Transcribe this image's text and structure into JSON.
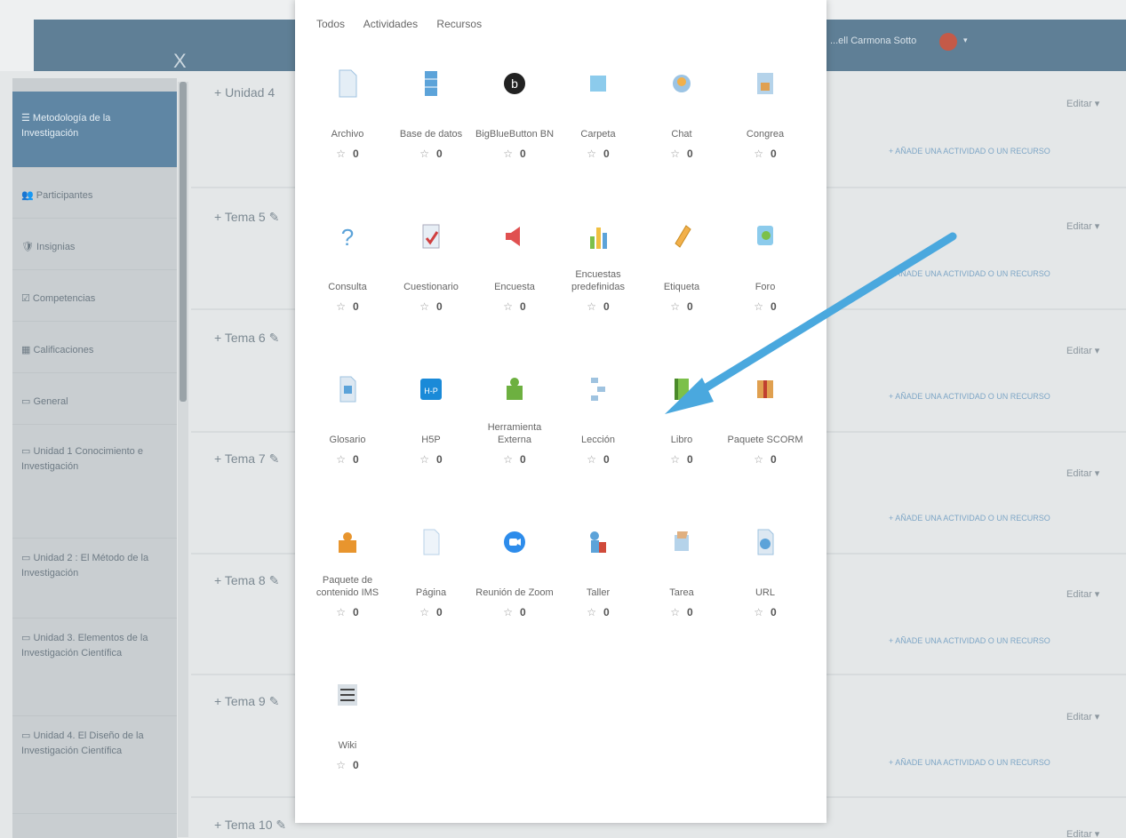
{
  "header": {
    "close_symbol": "X",
    "user_name": "...ell Carmona Sotto",
    "caret": "▾"
  },
  "sidebar": {
    "items": [
      {
        "label": "☰ Metodología de la Investigación",
        "active": true
      },
      {
        "label": "👥 Participantes"
      },
      {
        "label": "🛡 Insignias"
      },
      {
        "label": "☑ Competencias"
      },
      {
        "label": "▦ Calificaciones"
      },
      {
        "label": "▭ General"
      },
      {
        "label": "▭ Unidad 1 Conocimiento e Investigación"
      },
      {
        "label": "▭ Unidad 2 : El Método de la Investigación"
      },
      {
        "label": "▭ Unidad 3. Elementos de la Investigación Científica"
      },
      {
        "label": "▭ Unidad 4. El Diseño de la Investigación Científica"
      }
    ]
  },
  "sections": [
    {
      "title": "+ Unidad 4",
      "edit": "Editar ▾",
      "add": "+ AÑADE UNA ACTIVIDAD O UN RECURSO"
    },
    {
      "title": "+ Tema 5 ✎",
      "edit": "Editar ▾",
      "add": "+ AÑADE UNA ACTIVIDAD O UN RECURSO"
    },
    {
      "title": "+ Tema 6 ✎",
      "edit": "Editar ▾",
      "add": "+ AÑADE UNA ACTIVIDAD O UN RECURSO"
    },
    {
      "title": "+ Tema 7 ✎",
      "edit": "Editar ▾",
      "add": "+ AÑADE UNA ACTIVIDAD O UN RECURSO"
    },
    {
      "title": "+ Tema 8 ✎",
      "edit": "Editar ▾",
      "add": "+ AÑADE UNA ACTIVIDAD O UN RECURSO"
    },
    {
      "title": "+ Tema 9 ✎",
      "edit": "Editar ▾",
      "add": "+ AÑADE UNA ACTIVIDAD O UN RECURSO"
    },
    {
      "title": "+ Tema 10 ✎",
      "edit": "Editar ▾",
      "add": ""
    }
  ],
  "modal": {
    "tabs": [
      "Todos",
      "Actividades",
      "Recursos"
    ],
    "star": "☆",
    "tiles": [
      {
        "label": "Archivo",
        "count": "0",
        "icon": "file-icon"
      },
      {
        "label": "Base de datos",
        "count": "0",
        "icon": "database-icon"
      },
      {
        "label": "BigBlueButton BN",
        "count": "0",
        "icon": "bigbluebutton-icon"
      },
      {
        "label": "Carpeta",
        "count": "0",
        "icon": "folder-icon"
      },
      {
        "label": "Chat",
        "count": "0",
        "icon": "chat-icon"
      },
      {
        "label": "Congrea",
        "count": "0",
        "icon": "congrea-icon"
      },
      {
        "label": "Consulta",
        "count": "0",
        "icon": "question-icon"
      },
      {
        "label": "Cuestionario",
        "count": "0",
        "icon": "quiz-icon"
      },
      {
        "label": "Encuesta",
        "count": "0",
        "icon": "megaphone-icon"
      },
      {
        "label": "Encuestas predefinidas",
        "count": "0",
        "icon": "bar-chart-icon"
      },
      {
        "label": "Etiqueta",
        "count": "0",
        "icon": "tag-icon"
      },
      {
        "label": "Foro",
        "count": "0",
        "icon": "forum-icon"
      },
      {
        "label": "Glosario",
        "count": "0",
        "icon": "glossary-icon"
      },
      {
        "label": "H5P",
        "count": "0",
        "icon": "h5p-icon"
      },
      {
        "label": "Herramienta Externa",
        "count": "0",
        "icon": "puzzle-icon"
      },
      {
        "label": "Lección",
        "count": "0",
        "icon": "lesson-icon"
      },
      {
        "label": "Libro",
        "count": "0",
        "icon": "book-icon"
      },
      {
        "label": "Paquete SCORM",
        "count": "0",
        "icon": "package-icon"
      },
      {
        "label": "Paquete de contenido IMS",
        "count": "0",
        "icon": "ims-package-icon"
      },
      {
        "label": "Página",
        "count": "0",
        "icon": "page-icon"
      },
      {
        "label": "Reunión de Zoom",
        "count": "0",
        "icon": "zoom-icon"
      },
      {
        "label": "Taller",
        "count": "0",
        "icon": "workshop-icon"
      },
      {
        "label": "Tarea",
        "count": "0",
        "icon": "assignment-icon"
      },
      {
        "label": "URL",
        "count": "0",
        "icon": "url-icon"
      },
      {
        "label": "Wiki",
        "count": "0",
        "icon": "wiki-icon"
      }
    ]
  },
  "colors": {
    "header_blue": "#5f7f96",
    "sidebar_active": "#5f86a4",
    "arrow": "#4aa8de",
    "add_link": "#7ea6c6"
  }
}
